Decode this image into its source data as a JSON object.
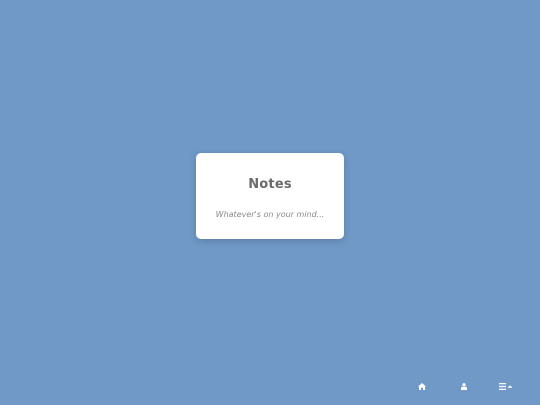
{
  "note": {
    "title": "Notes",
    "placeholder": "Whatever's on your mind..."
  },
  "nav": {
    "items": [
      {
        "name": "home",
        "icon": "home-icon"
      },
      {
        "name": "user",
        "icon": "user-icon"
      },
      {
        "name": "menu",
        "icon": "menu-icon"
      }
    ]
  },
  "colors": {
    "background": "#7099c8",
    "card": "#ffffff",
    "title_text": "#6b6b6b",
    "placeholder_text": "#8a8a8a",
    "icon": "#ffffff"
  }
}
